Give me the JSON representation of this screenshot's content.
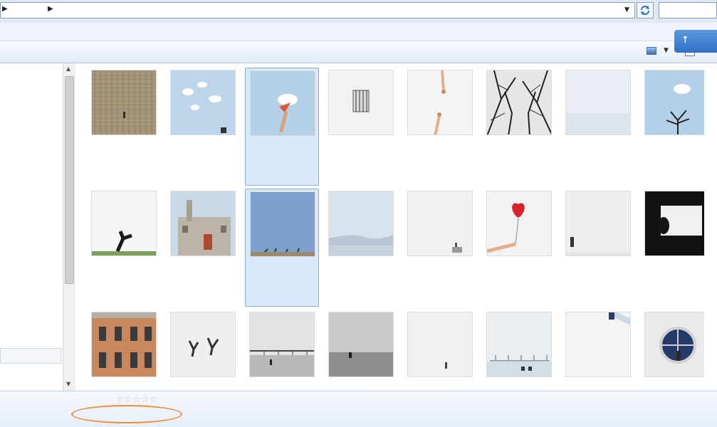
{
  "address_bar": {
    "path": [
      {
        "label": ""
      },
      {
        "label": ""
      }
    ],
    "search_placeholder": ""
  },
  "menubar": {
    "help_label": ""
  },
  "toolbar": {
    "items": [
      {
        "label": ""
      },
      {
        "label": ""
      },
      {
        "label": ""
      },
      {
        "label": ""
      },
      {
        "label": ""
      }
    ]
  },
  "upload_badge": {
    "label": ""
  },
  "files": [
    {
      "name": ""
    },
    {
      "name": ""
    },
    {
      "name": "",
      "selected": true
    },
    {
      "name": ""
    },
    {
      "name": ""
    },
    {
      "name": ""
    },
    {
      "name": ""
    },
    {
      "name": ""
    },
    {
      "name": ""
    },
    {
      "name": ""
    },
    {
      "name": "",
      "selected": true
    },
    {
      "name": ""
    },
    {
      "name": ""
    },
    {
      "name": ""
    },
    {
      "name": ""
    },
    {
      "name": ""
    },
    {
      "name": ""
    },
    {
      "name": ""
    },
    {
      "name": ""
    },
    {
      "name": ""
    },
    {
      "name": ""
    },
    {
      "name": ""
    },
    {
      "name": ""
    },
    {
      "name": ""
    }
  ],
  "details_pane": {
    "file_name": "",
    "rating_label": "",
    "dimensions_label": "",
    "dimensions_value": "",
    "size_label": "",
    "bottom_left": "",
    "author_label": "",
    "author_value": "",
    "notes_label": "",
    "notes_value": "",
    "camera_label": "",
    "subject_label": "",
    "subject_value": "",
    "created_label": "",
    "created_value": "",
    "modified_label": "",
    "modified_value": ""
  }
}
